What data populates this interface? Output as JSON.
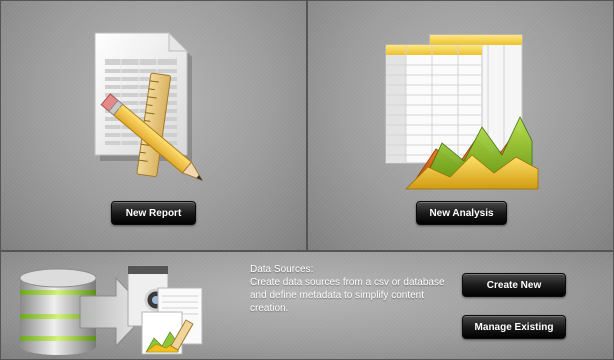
{
  "report_panel": {
    "button_label": "New Report",
    "icon": "report-document-pencil-ruler-icon"
  },
  "analysis_panel": {
    "button_label": "New Analysis",
    "icon": "spreadsheet-area-chart-icon"
  },
  "datasource_panel": {
    "title": "Data Sources:",
    "description": "Create data sources from a csv or database and define metadata to simplify content creation.",
    "icon": "database-to-documents-icon",
    "create_label": "Create New",
    "manage_label": "Manage Existing"
  },
  "colors": {
    "button_bg": "#111111",
    "button_text": "#ffffff",
    "panel_bg": "#9e9e9e"
  }
}
